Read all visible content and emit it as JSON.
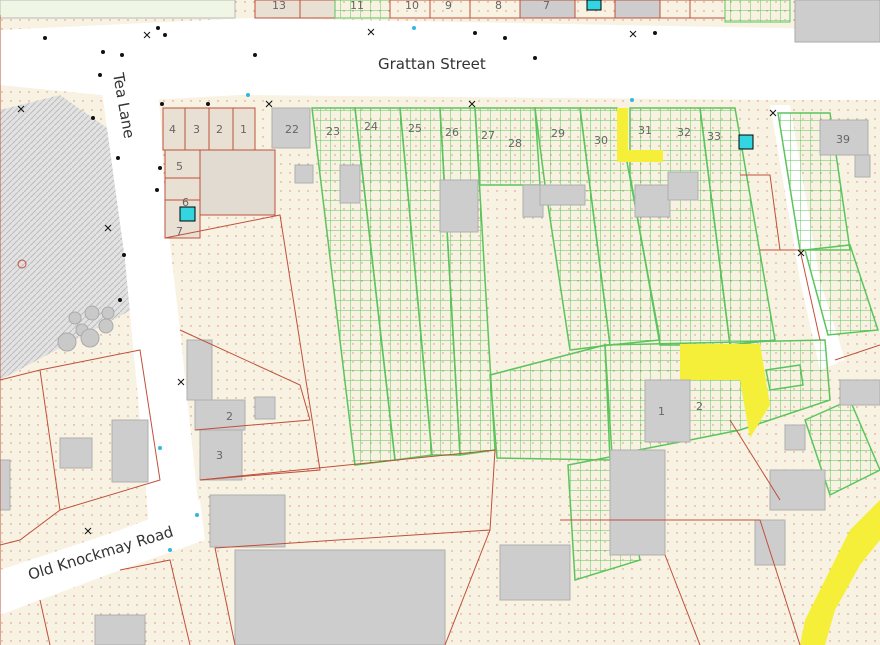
{
  "map": {
    "streets": {
      "grattan": "Grattan Street",
      "tea_lane": "Tea Lane",
      "old_knockmay": "Old Knockmay Road"
    },
    "plots_top_row": [
      "13",
      "11",
      "10",
      "9",
      "8",
      "7"
    ],
    "plots_terrace": [
      "4",
      "3",
      "2",
      "1",
      "22",
      "23",
      "24",
      "25",
      "26",
      "27",
      "28",
      "29",
      "30",
      "31",
      "32",
      "33",
      "39"
    ],
    "plots_lane": [
      "5",
      "6",
      "7"
    ],
    "plots_lower": [
      "2",
      "3"
    ],
    "plots_middle": [
      "1",
      "2"
    ],
    "colors": {
      "background": "#f7f2e2",
      "road": "#ffffff",
      "building": "#cdcdcd",
      "boundary": "#c0503c",
      "folio_green": "#5cc45c",
      "folio_yellow": "#f5ef3a",
      "marker_cyan": "#33d6e0"
    }
  }
}
